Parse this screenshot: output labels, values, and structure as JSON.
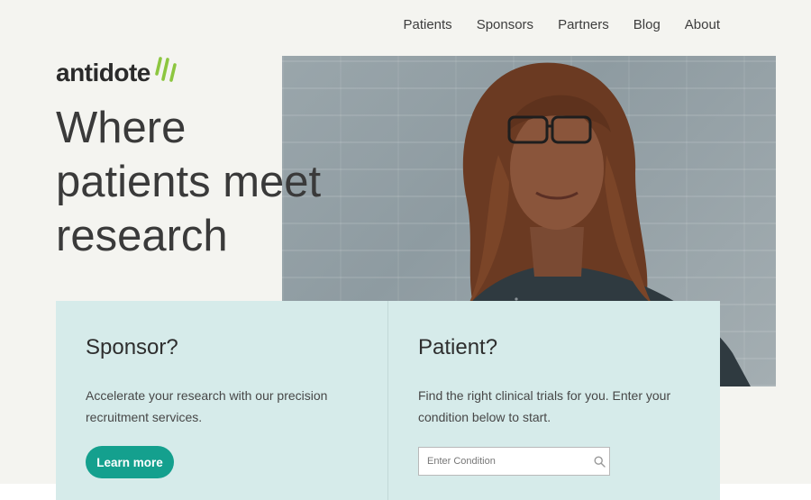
{
  "nav": {
    "items": [
      "Patients",
      "Sponsors",
      "Partners",
      "Blog",
      "About"
    ]
  },
  "logo": {
    "text": "antidote"
  },
  "hero": {
    "title_lines": [
      "Where",
      "patients meet",
      "research"
    ]
  },
  "sponsor_card": {
    "title": "Sponsor?",
    "text": "Accelerate your research with our precision recruitment services.",
    "button_label": "Learn more"
  },
  "patient_card": {
    "title": "Patient?",
    "text": "Find the right clinical trials for you. Enter your condition below to start.",
    "search_placeholder": "Enter Condition"
  },
  "colors": {
    "accent": "#14a08e",
    "logo_mark": "#8cc63f",
    "card_bg": "#d6ebea",
    "page_bg": "#f4f4f0"
  },
  "icons": {
    "search": "search-icon",
    "logo_mark": "slash-mark-icon"
  }
}
